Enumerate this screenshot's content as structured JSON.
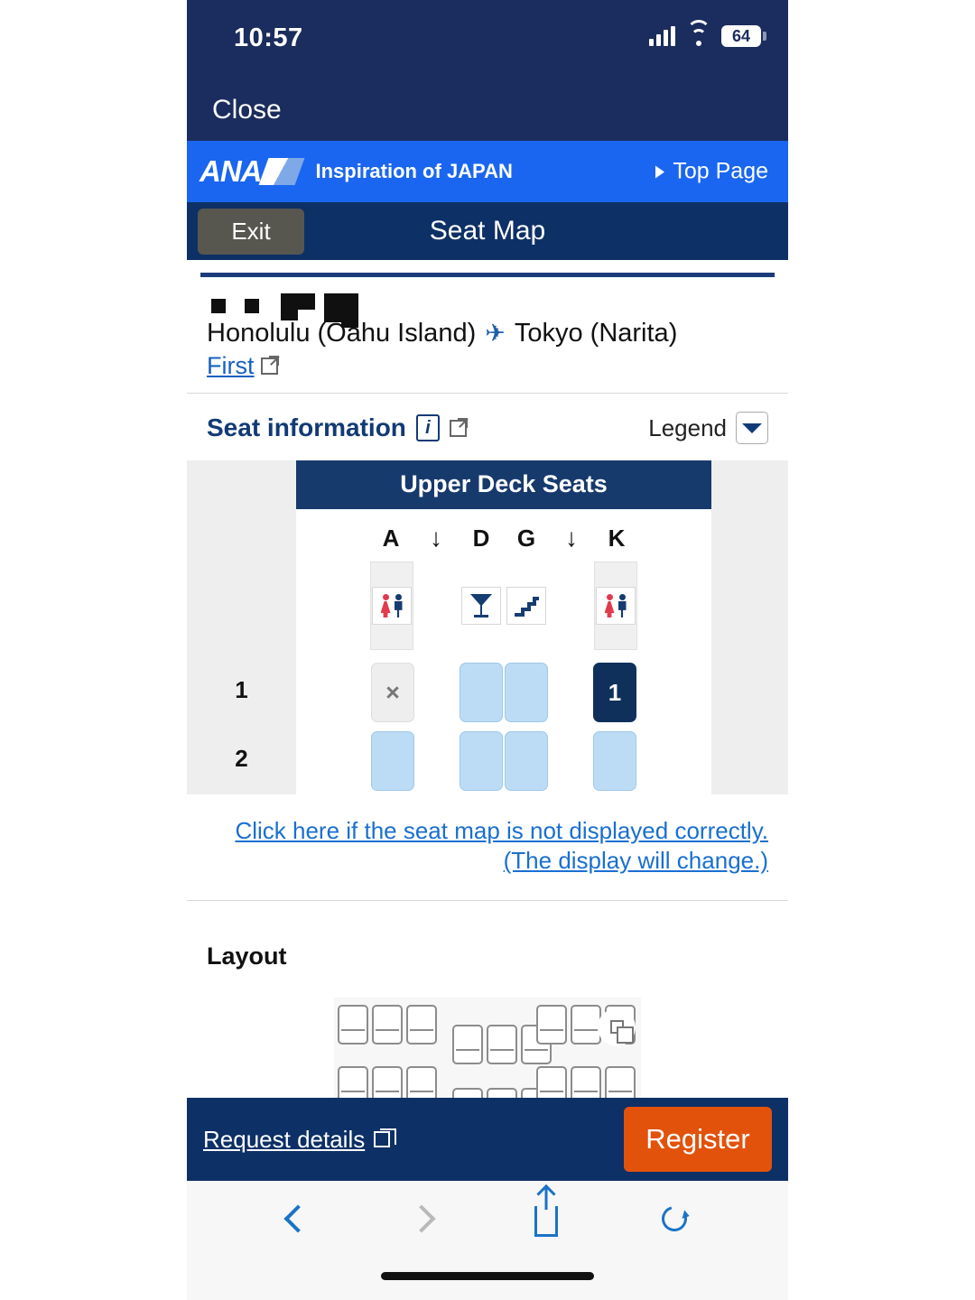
{
  "status_bar": {
    "time": "10:57",
    "battery_level": "64",
    "signal_icon": "cellular-bars-icon",
    "wifi_icon": "wifi-icon"
  },
  "close_bar": {
    "label": "Close"
  },
  "brand_bar": {
    "logo_text": "ANA",
    "slogan": "Inspiration of JAPAN",
    "top_page_label": "Top Page",
    "background_color": "#1a66f0"
  },
  "nav_bar": {
    "exit_label": "Exit",
    "title": "Seat Map",
    "background_color": "#0d3066"
  },
  "route": {
    "origin": "Honolulu (Oahu Island)",
    "plane_icon": "airplane-icon",
    "destination": "Tokyo (Narita)",
    "cabin_class": "First",
    "external_icon": "external-link-icon"
  },
  "seat_information": {
    "title": "Seat information",
    "info_icon": "info-icon",
    "external_icon": "external-link-icon",
    "legend_label": "Legend",
    "legend_toggle_icon": "chevron-down-icon"
  },
  "seat_map": {
    "deck_title": "Upper Deck Seats",
    "columns": [
      "A",
      "↓",
      "D",
      "G",
      "↓",
      "K"
    ],
    "facilities": [
      {
        "name": "lavatory",
        "icons": [
          "lavatory-female-icon",
          "lavatory-male-icon"
        ]
      },
      {
        "name": "bar",
        "icons": [
          "cocktail-glass-icon"
        ]
      },
      {
        "name": "stairs",
        "icons": [
          "stairs-icon"
        ]
      },
      {
        "name": "lavatory",
        "icons": [
          "lavatory-female-icon",
          "lavatory-male-icon"
        ]
      }
    ],
    "rows": [
      {
        "number": "1",
        "seats": [
          {
            "id": "1A",
            "state": "blocked",
            "label": "×"
          },
          {
            "id": "1D",
            "state": "available",
            "label": ""
          },
          {
            "id": "1G",
            "state": "available",
            "label": ""
          },
          {
            "id": "1K",
            "state": "selected",
            "label": "1"
          }
        ]
      },
      {
        "number": "2",
        "seats": [
          {
            "id": "2A",
            "state": "available",
            "label": ""
          },
          {
            "id": "2D",
            "state": "available",
            "label": ""
          },
          {
            "id": "2G",
            "state": "available",
            "label": ""
          },
          {
            "id": "2K",
            "state": "available",
            "label": ""
          }
        ]
      }
    ],
    "colors": {
      "available": "#bcdcf5",
      "selected": "#10305c",
      "blocked": "#eeeeee",
      "deck_header": "#173a6d"
    }
  },
  "notice": {
    "line1": "Click here if the seat map is not displayed correctly.",
    "line2": "(The display will change.)"
  },
  "layout": {
    "title": "Layout",
    "expand_icon": "expand-window-icon"
  },
  "action_bar": {
    "request_details_label": "Request details",
    "request_icon": "open-window-icon",
    "register_label": "Register",
    "register_color": "#e2520b"
  },
  "browser_toolbar": {
    "back_icon": "chevron-left-icon",
    "forward_icon": "chevron-right-icon",
    "share_icon": "share-icon",
    "reload_icon": "reload-icon"
  }
}
